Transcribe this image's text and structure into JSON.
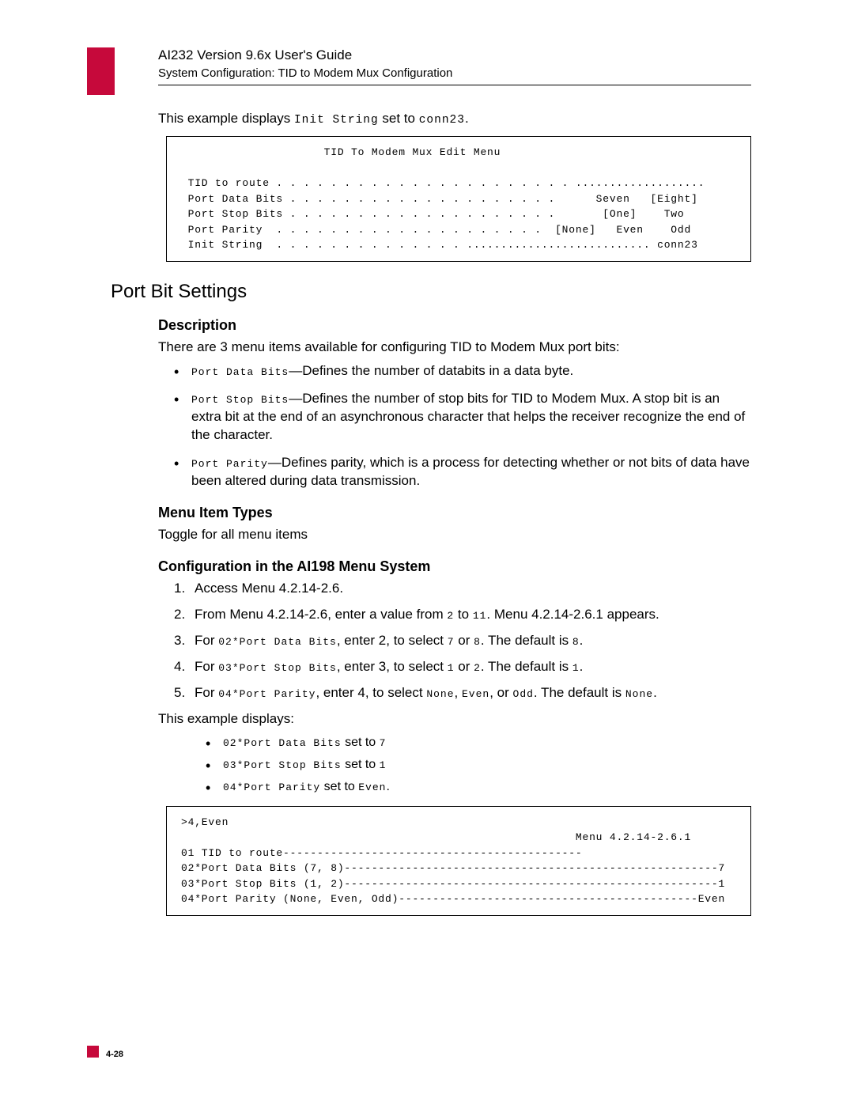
{
  "header": {
    "title": "AI232 Version 9.6x User's Guide",
    "subtitle": "System Configuration: TID to Modem Mux Configuration"
  },
  "intro": {
    "pre": "This example displays ",
    "code": "Init String",
    "mid": " set to ",
    "val": "conn23",
    "post": "."
  },
  "term1": "                     TID To Modem Mux Edit Menu\n\n TID to route . . . . . . . . . . . . . . . . . . . . . . ...................\n Port Data Bits . . . . . . . . . . . . . . . . . . . .      Seven   [Eight]\n Port Stop Bits . . . . . . . . . . . . . . . . . . . .       [One]    Two\n Port Parity  . . . . . . . . . . . . . . . . . . . .  [None]   Even    Odd\n Init String  . . . . . . . . . . . . . . ........................... conn23",
  "section_title": "Port Bit Settings",
  "desc_h": "Description",
  "desc_p": "There are 3 menu items available for configuring TID to Modem Mux port bits:",
  "b1": {
    "code": "Port Data Bits",
    "text": "—Defines the number of databits in a data byte."
  },
  "b2": {
    "code": "Port Stop Bits",
    "text": "—Defines the number of stop bits for TID to Modem Mux. A stop bit is an extra bit at the end of an asynchronous character that helps the receiver recognize the end of the character."
  },
  "b3": {
    "code": "Port Parity",
    "text": "—Defines parity, which is a process for detecting whether or not bits of data have been altered during data transmission."
  },
  "mit_h": "Menu Item Types",
  "mit_p": "Toggle for all menu items",
  "cfg_h": "Configuration in the AI198 Menu System",
  "s1": "Access Menu 4.2.14-2.6.",
  "s2": {
    "a": "From Menu 4.2.14-2.6, enter a value from ",
    "c1": "2",
    "b": " to ",
    "c2": "11",
    "c": ". Menu 4.2.14-2.6.1 appears."
  },
  "s3": {
    "a": "For ",
    "c1": "02*Port Data Bits",
    "b": ", enter ",
    "v": "2",
    "c": ",  to select ",
    "o1": "7",
    "d": " or ",
    "o2": "8",
    "e": ". The default is ",
    "df": "8",
    "f": "."
  },
  "s4": {
    "a": "For ",
    "c1": "03*Port Stop Bits",
    "b": ", enter ",
    "v": "3",
    "c": ",  to select ",
    "o1": "1",
    "d": " or ",
    "o2": "2",
    "e": ". The default is ",
    "df": "1",
    "f": "."
  },
  "s5": {
    "a": "For ",
    "c1": "04*Port Parity",
    "b": ", enter ",
    "v": "4",
    "c": ",  to select ",
    "o1": "None",
    "d": ", ",
    "o2": "Even",
    "e": ", or ",
    "o3": "Odd",
    "g": ". The default is ",
    "df": "None",
    "f": "."
  },
  "ex_p": "This example displays:",
  "sb1": {
    "c": "02*Port Data Bits",
    "m": " set to ",
    "v": "7"
  },
  "sb2": {
    "c": "03*Port Stop Bits",
    "m": " set to ",
    "v": "1"
  },
  "sb3": {
    "c": "04*Port Parity",
    "m": " set to ",
    "v": "Even",
    "p": "."
  },
  "term2": ">4,Even\n                                                          Menu 4.2.14-2.6.1\n01 TID to route--------------------------------------------\n02*Port Data Bits (7, 8)-------------------------------------------------------7\n03*Port Stop Bits (1, 2)-------------------------------------------------------1\n04*Port Parity (None, Even, Odd)--------------------------------------------Even",
  "page_num": "4-28"
}
